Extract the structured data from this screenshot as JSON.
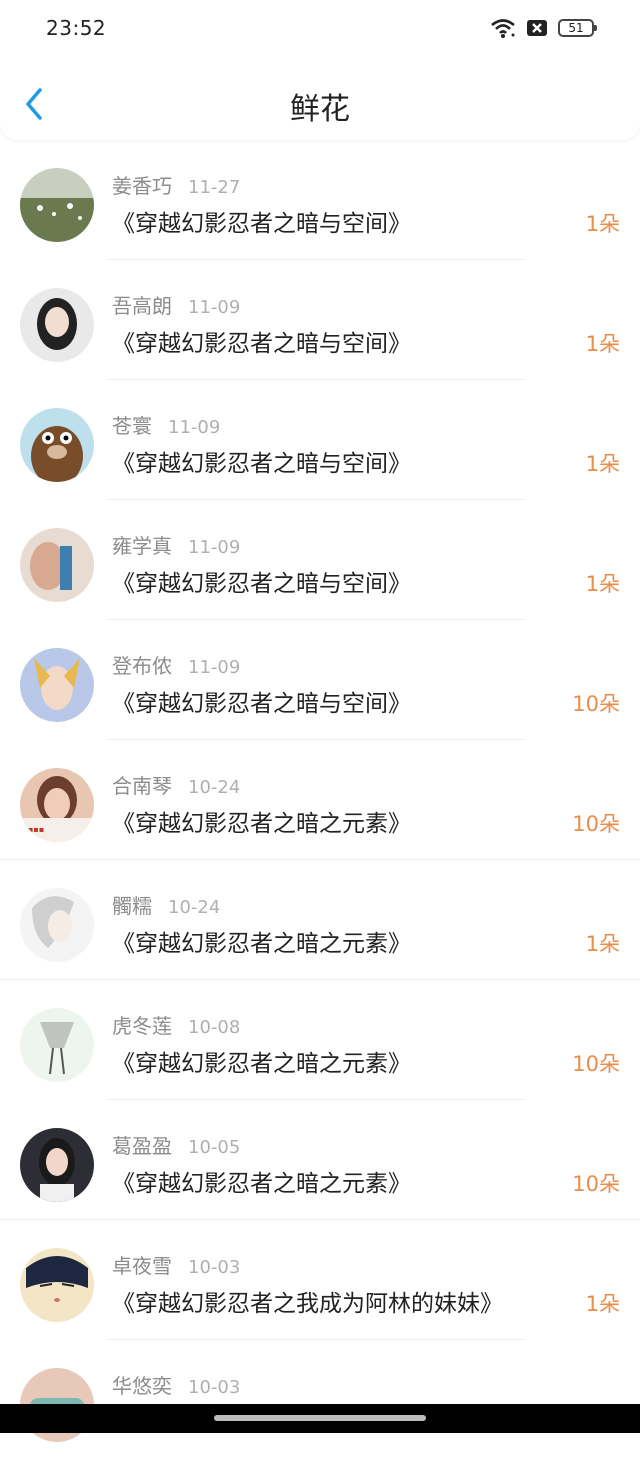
{
  "status": {
    "time": "23:52",
    "battery": "51"
  },
  "header": {
    "title": "鲜花"
  },
  "items": [
    {
      "name": "姜香巧",
      "date": "11-27",
      "book": "《穿越幻影忍者之暗与空间》",
      "qty": "1朵"
    },
    {
      "name": "吾高朗",
      "date": "11-09",
      "book": "《穿越幻影忍者之暗与空间》",
      "qty": "1朵"
    },
    {
      "name": "苍寰",
      "date": "11-09",
      "book": "《穿越幻影忍者之暗与空间》",
      "qty": "1朵"
    },
    {
      "name": "雍学真",
      "date": "11-09",
      "book": "《穿越幻影忍者之暗与空间》",
      "qty": "1朵"
    },
    {
      "name": "登布侬",
      "date": "11-09",
      "book": "《穿越幻影忍者之暗与空间》",
      "qty": "10朵"
    },
    {
      "name": "合南琴",
      "date": "10-24",
      "book": "《穿越幻影忍者之暗之元素》",
      "qty": "10朵"
    },
    {
      "name": "髑糯",
      "date": "10-24",
      "book": "《穿越幻影忍者之暗之元素》",
      "qty": "1朵"
    },
    {
      "name": "虎冬莲",
      "date": "10-08",
      "book": "《穿越幻影忍者之暗之元素》",
      "qty": "10朵"
    },
    {
      "name": "葛盈盈",
      "date": "10-05",
      "book": "《穿越幻影忍者之暗之元素》",
      "qty": "10朵"
    },
    {
      "name": "卓夜雪",
      "date": "10-03",
      "book": "《穿越幻影忍者之我成为阿林的妹妹》",
      "qty": "1朵"
    },
    {
      "name": "华悠奕",
      "date": "10-03",
      "book": "",
      "qty": ""
    }
  ],
  "colors": {
    "accent": "#1e9be9",
    "qty": "#ec8c46"
  }
}
